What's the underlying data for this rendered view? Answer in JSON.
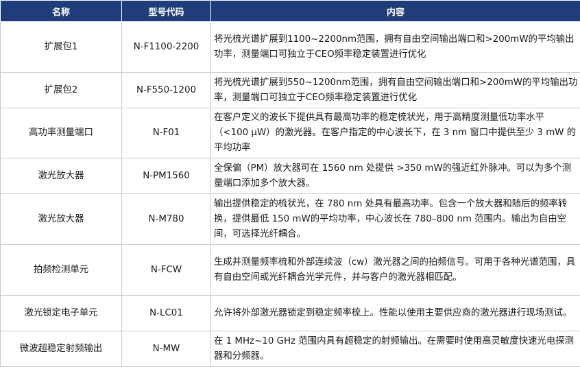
{
  "headers": {
    "name": "名称",
    "code": "型号代码",
    "desc": "内容"
  },
  "rows": [
    {
      "name": "扩展包1",
      "code": "N-F1100-2200",
      "desc": "将光梳光谱扩展到1100~2200nm范围，拥有自由空间输出端口和>200mW的平均输出功率，测量端口可独立于CEO频率稳定装置进行优化"
    },
    {
      "name": "扩展包2",
      "code": "N-F550-1200",
      "desc": "将光梳光谱扩展到550~1200nm范围，拥有自由空间输出端口和>200mW的平均输出功率，测量端口可独立于CEO频率稳定装置进行优化"
    },
    {
      "name": "高功率测量端口",
      "code": "N-F01",
      "desc": "在客户定义的波长下提供具有最高功率的稳定梳状光，用于高精度测量低功率水平（<100 μW）的激光器。在客户指定的中心波长下，在 3 nm 窗口中提供至少 3 mW 的平均功率"
    },
    {
      "name": "激光放大器",
      "code": "N-PM1560",
      "desc": "全保偏（PM）放大器可在 1560 nm 处提供 >350 mW的强近红外脉冲。可以为多个测量端口添加多个放大器。"
    },
    {
      "name": "激光放大器",
      "code": "N-M780",
      "desc": "输出提供稳定的梳状光，在 780 nm 处具有最高功率。包含一个放大器和随后的频率转换，提供最低 150 mW的平均功率，中心波长在 780–800 nm 范围内。输出为自由空间，可选择光纤耦合。"
    },
    {
      "name": "拍频检测单元",
      "code": "N-FCW",
      "desc": "生成并测量频率梳和外部连续波（cw）激光器之间的拍频信号。可用于各种光谱范围，具有自由空间或光纤耦合光学元件，并与客户的激光器相匹配。"
    },
    {
      "name": "激光锁定电子单元",
      "code": "N-LC01",
      "desc": "允许将外部激光器锁定到稳定频率梳上。性能以使用主要供应商的激光器进行现场测试。"
    },
    {
      "name": "微波超稳定射频输出",
      "code": "N-MW",
      "desc": "在 1 MHz~10 GHz 范围内具有超稳定的射频输出。在需要时使用高灵敏度快速光电探测器和分频器。"
    }
  ]
}
